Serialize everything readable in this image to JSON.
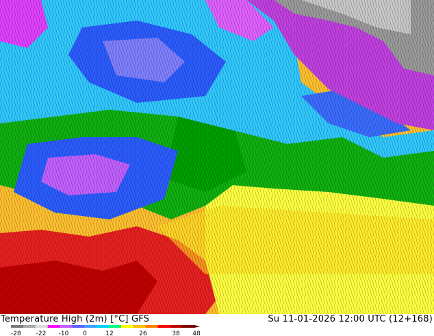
{
  "title": "Temperature High (2m) [°C] GFS",
  "run_label": "Su 11-01-2026 12:00 UTC (12+168)",
  "legend": {
    "ticks": [
      "-28",
      "-22",
      "-10",
      "0",
      "12",
      "26",
      "38",
      "48"
    ],
    "colors": [
      "#7a7a7a",
      "#a8a8a8",
      "#dcdcdc",
      "#ff00ff",
      "#c060ff",
      "#6060ff",
      "#3fa0ff",
      "#00d0ff",
      "#00ff7f",
      "#ffff00",
      "#ffc000",
      "#ff7f00",
      "#ff0000",
      "#c00000",
      "#800000"
    ]
  }
}
